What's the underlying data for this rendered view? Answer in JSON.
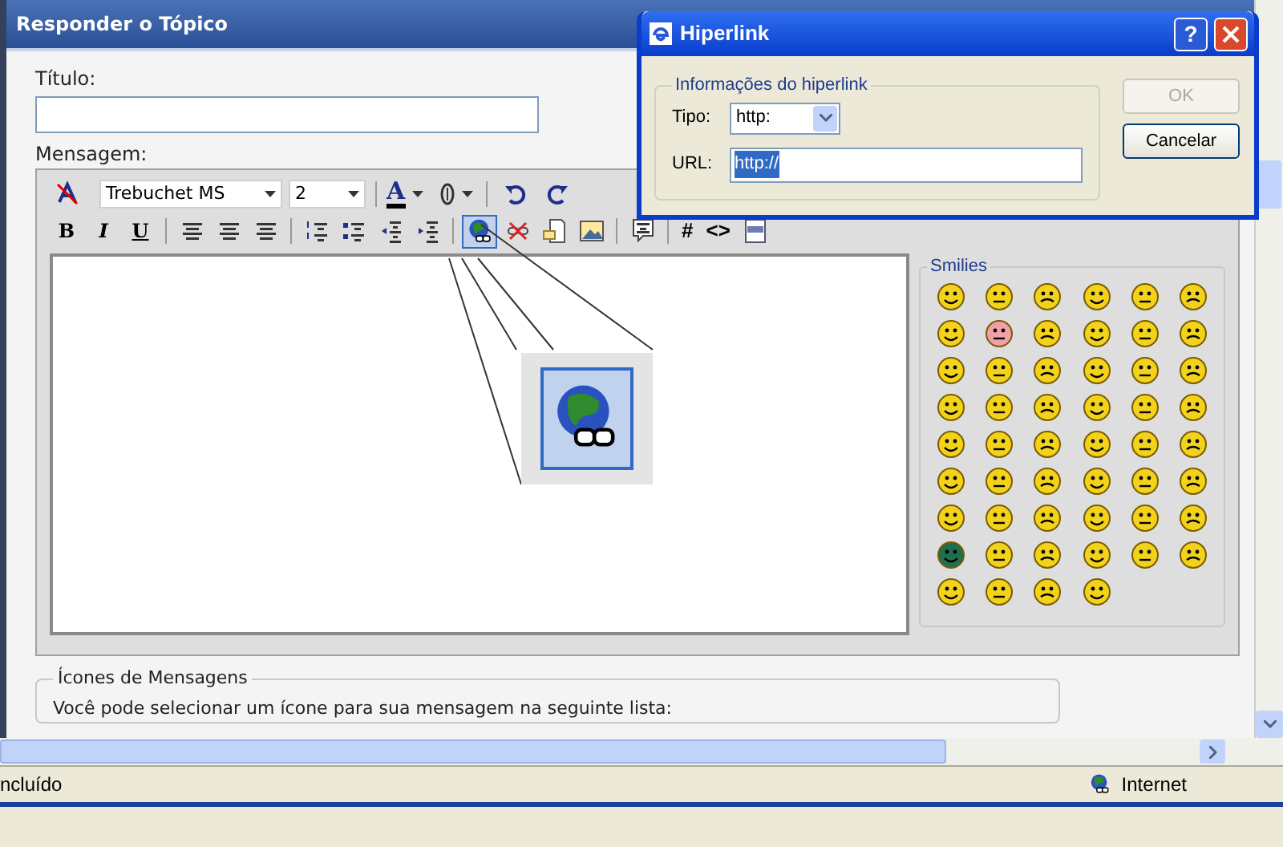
{
  "page_title": "Responder o Tópico",
  "title_field": {
    "label": "Título:"
  },
  "message": {
    "label": "Mensagem:"
  },
  "toolbar": {
    "font": "Trebuchet MS",
    "size": "2",
    "color_letter": "A",
    "format_buttons": [
      {
        "label": "B"
      },
      {
        "label": "I"
      },
      {
        "label": "U"
      }
    ],
    "hyperlink_selected": true,
    "code_buttons": [
      {
        "label": "#"
      },
      {
        "label": "<>"
      }
    ]
  },
  "smilies": {
    "legend": "Smilies"
  },
  "message_icons": {
    "legend": "Ícones de Mensagens",
    "text": "Você pode selecionar um ícone para sua mensagem na seguinte lista:"
  },
  "status_bar": {
    "text": "ncluído",
    "zone": "Internet"
  },
  "dialog": {
    "title": "Hiperlink",
    "help": "?",
    "group": "Informações do hiperlink",
    "type_label": "Tipo:",
    "type_value": "http:",
    "url_label": "URL:",
    "url_value": "http://",
    "url_selected": true,
    "buttons": [
      {
        "label": "OK",
        "disabled": true
      },
      {
        "label": "Cancelar",
        "disabled": false
      }
    ]
  }
}
